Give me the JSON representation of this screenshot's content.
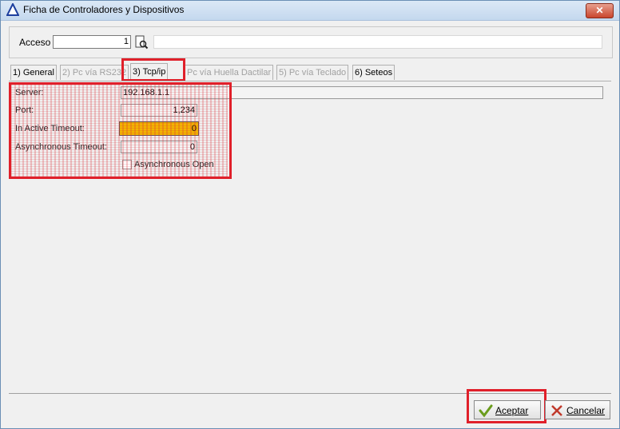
{
  "window": {
    "title": "Ficha de  Controladores y Dispositivos",
    "close_label": "✕"
  },
  "header": {
    "acceso_label": "Acceso",
    "acceso_value": "1",
    "search_icon": "search-document-icon"
  },
  "tabs": [
    {
      "label": "1) General",
      "state": "normal"
    },
    {
      "label": "2) Pc vía RS232",
      "state": "disabled"
    },
    {
      "label": "3) Tcp/ip",
      "state": "active"
    },
    {
      "label": "Pc vía Huella Dactilar",
      "state": "disabled"
    },
    {
      "label": "5) Pc vía Teclado",
      "state": "disabled"
    },
    {
      "label": "6) Seteos",
      "state": "normal"
    }
  ],
  "tcpip": {
    "server_label": "Server:",
    "server_value": "192.168.1.1",
    "port_label": "Port:",
    "port_value": "1,234",
    "inactive_timeout_label": "In Active Timeout:",
    "inactive_timeout_value": "0",
    "async_timeout_label": "Asynchronous Timeout:",
    "async_timeout_value": "0",
    "async_open_label": "Asynchronous Open"
  },
  "buttons": {
    "accept_label": "Aceptar",
    "cancel_label": "Cancelar"
  },
  "colors": {
    "highlight": "#e0202a",
    "focus_field": "#f2b400",
    "accept_icon": "#6a9c1c",
    "cancel_icon": "#c0392b"
  }
}
